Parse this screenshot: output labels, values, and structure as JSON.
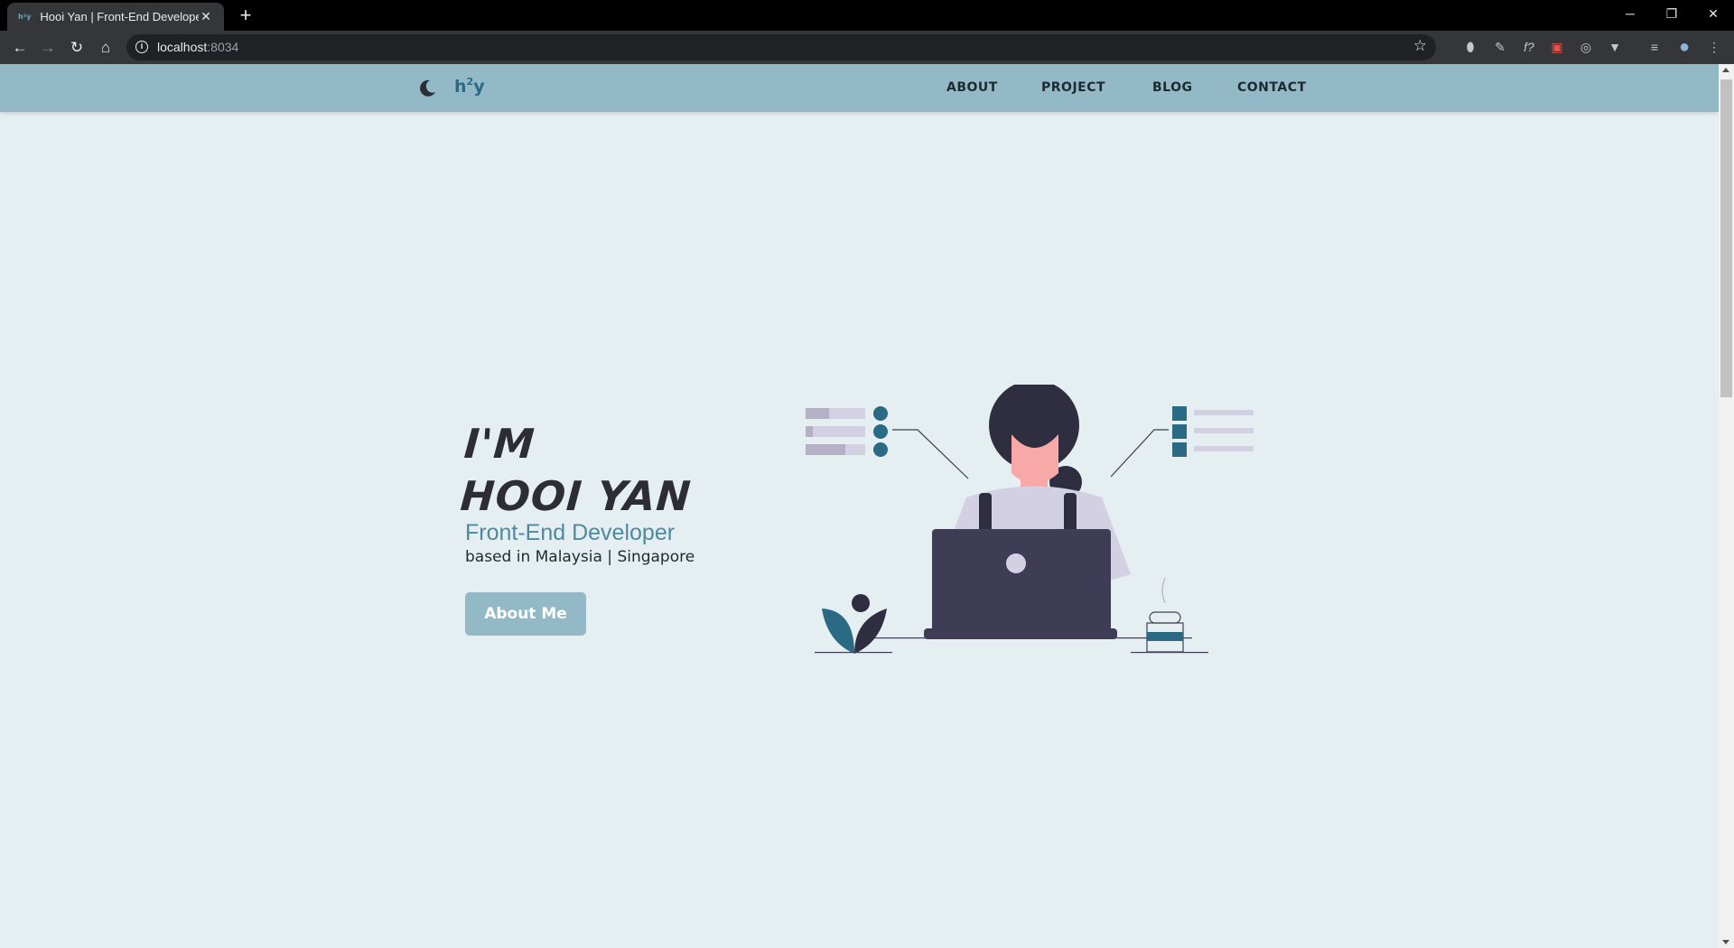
{
  "browser": {
    "tab": {
      "favicon_text": "h²y",
      "title": "Hooi Yan | Front-End Developer",
      "close_glyph": "✕"
    },
    "new_tab_glyph": "+",
    "window_controls": {
      "minimize": "─",
      "restore": "❐",
      "close": "✕"
    },
    "nav": {
      "back": "←",
      "forward": "→",
      "reload": "↻",
      "home": "⌂"
    },
    "address": {
      "host": "localhost",
      "port": ":8034"
    },
    "bookmark_glyph": "☆",
    "extensions": [
      "⬮",
      "✎",
      "f?",
      "▣",
      "◎",
      "▼",
      "≡",
      "●",
      "⋮"
    ]
  },
  "site": {
    "logo": {
      "text": "h",
      "sup": "2",
      "suffix": "y"
    },
    "nav_links": [
      "ABOUT",
      "PROJECT",
      "BLOG",
      "CONTACT"
    ],
    "hero": {
      "title_line1": "I'M",
      "title_line2": "HOOI YAN",
      "role": "Front-End Developer",
      "location": "based in Malaysia | Singapore",
      "button": "About Me"
    }
  },
  "colors": {
    "page_bg": "#e5eef1",
    "nav_bg": "#93b9c7",
    "accent": "#2a6a84",
    "role_text": "#4d8aa0",
    "dark": "#3f3d56",
    "lavender": "#d3d0e3"
  },
  "icons": {
    "theme_toggle": "moon-icon",
    "tab_favicon": "site-favicon-icon",
    "info": "info-icon",
    "bookmark": "star-icon"
  }
}
